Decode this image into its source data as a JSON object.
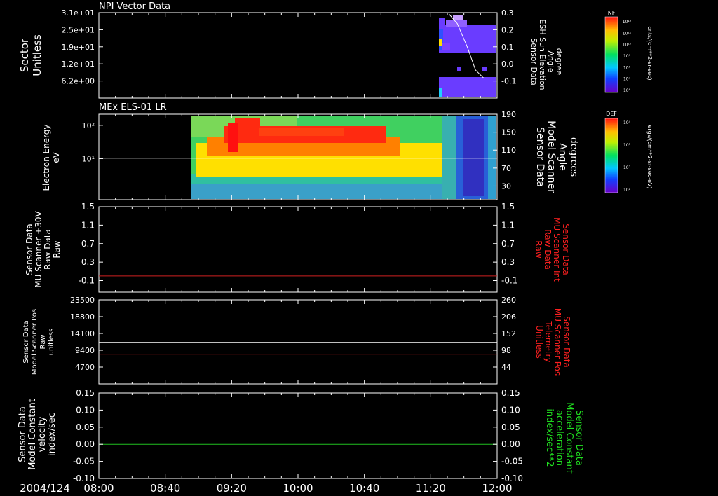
{
  "time_axis": {
    "date_label": "2004/124",
    "ticks": [
      "08:00",
      "08:40",
      "09:20",
      "10:00",
      "10:40",
      "11:20",
      "12:00"
    ]
  },
  "colors": {
    "red_axis": "#ff2020",
    "green_axis": "#20e020",
    "white": "#ffffff"
  },
  "chart_data": [
    {
      "type": "heatmap",
      "title": "NPI Vector Data",
      "ylabel": [
        "Sector",
        "Unitless"
      ],
      "yticks": [
        "3.1e+01",
        "2.5e+01",
        "1.9e+01",
        "1.2e+01",
        "6.2e+00"
      ],
      "y2label": [
        "Sensor Data",
        "ESH Sun Elevation",
        "Angle",
        "degree"
      ],
      "y2ticks": [
        "0.3",
        "0.2",
        "0.1",
        "0.0",
        "-0.1"
      ],
      "colorbar": {
        "label": "NF",
        "unit": "cnts/(cm**2-sr-sec)",
        "ticks": [
          "10¹²",
          "10¹¹",
          "10¹⁰",
          "10⁹",
          "10⁸",
          "10⁷",
          "10⁶"
        ]
      },
      "overlay_line": {
        "name": "ESH Sun Elevation Angle",
        "x": [
          "11:31",
          "11:36",
          "11:42",
          "11:47",
          "11:52"
        ],
        "y": [
          0.29,
          0.22,
          0.05,
          -0.12,
          -0.18
        ]
      }
    },
    {
      "type": "heatmap",
      "title": "MEx ELS-01 LR",
      "ylabel": [
        "Electron Energy",
        "eV"
      ],
      "yticks": [
        "10²",
        "10¹"
      ],
      "y2label": [
        "Sensor Data",
        "Model Scanner",
        "Angle",
        "degrees"
      ],
      "y2ticks": [
        "190",
        "150",
        "110",
        "70",
        "30"
      ],
      "colorbar": {
        "label": "DEF",
        "unit": "ergs/(cm**2-sr-sec-eV)",
        "ticks": [
          "10⁴",
          "10³",
          "10²",
          "10¹"
        ]
      },
      "overlay_line": {
        "name": "Model Scanner Angle",
        "y": 92
      }
    },
    {
      "type": "line",
      "ylabel": [
        "Sensor Data",
        "MU Scanner +30V",
        "Raw Data",
        "Raw"
      ],
      "yticks": [
        "1.5",
        "1.1",
        "0.7",
        "0.3",
        "-0.1"
      ],
      "ylim": [
        -0.35,
        1.5
      ],
      "y2label": [
        "Sensor Data",
        "MU Scanner Int",
        "Raw Data",
        "Raw"
      ],
      "y2ticks": [
        "1.5",
        "1.1",
        "0.7",
        "0.3",
        "-0.1"
      ],
      "series": [
        {
          "color": "#d02020",
          "y": 0.0
        }
      ]
    },
    {
      "type": "line",
      "ylabel": [
        "Sensor Data",
        "Model Scanner Pos",
        "Raw",
        "unitless"
      ],
      "yticks": [
        "23500",
        "18800",
        "14100",
        "9400",
        "4700"
      ],
      "ylim": [
        0,
        23500
      ],
      "y2label": [
        "Sensor Data",
        "MU Scanner Pos",
        "Telemetry",
        "Unitless"
      ],
      "y2ticks": [
        "260",
        "206",
        "152",
        "98",
        "44"
      ],
      "series": [
        {
          "color": "#ffffff",
          "y": 11600
        },
        {
          "color": "#e02020",
          "y": 8300
        }
      ]
    },
    {
      "type": "line",
      "ylabel": [
        "Sensor Data",
        "Model Constant",
        "velocity",
        "index/sec"
      ],
      "yticks": [
        "0.15",
        "0.10",
        "0.05",
        "0.00",
        "-0.05",
        "-0.10"
      ],
      "ylim": [
        -0.1,
        0.15
      ],
      "y2label": [
        "Sensor Data",
        "Model Constant",
        "acceleration",
        "index/sec**2"
      ],
      "y2ticks": [
        "0.15",
        "0.10",
        "0.05",
        "0.00",
        "-0.05",
        "-0.10"
      ],
      "series": [
        {
          "color": "#20c020",
          "y": 0.0
        }
      ]
    }
  ]
}
